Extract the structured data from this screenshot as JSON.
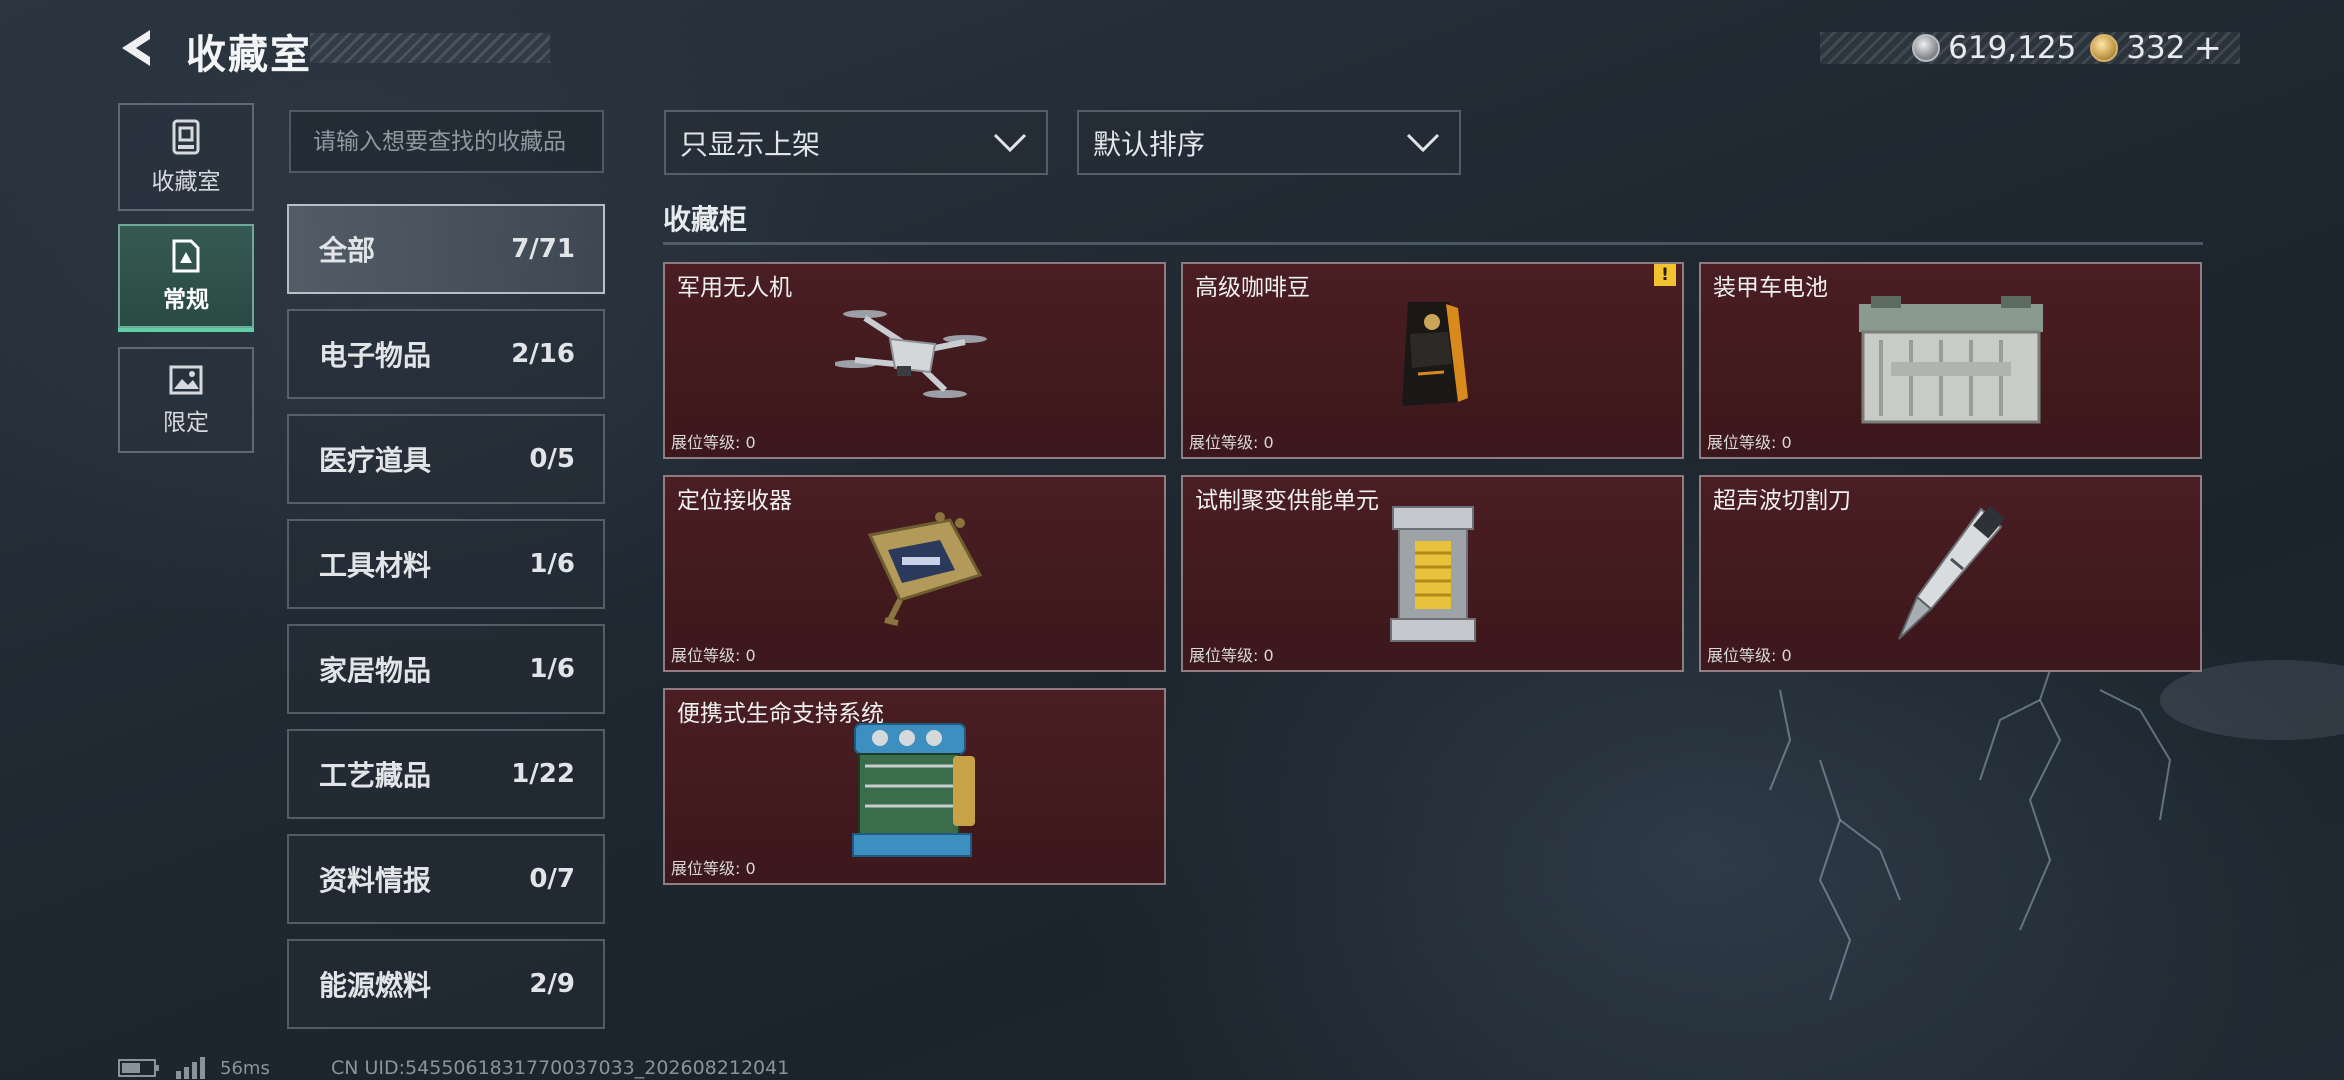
{
  "header": {
    "title": "收藏室",
    "currency_silver": "619,125",
    "currency_gold": "332",
    "plus_label": "+"
  },
  "side_tabs": [
    {
      "label": "收藏室",
      "icon": "vault-icon"
    },
    {
      "label": "常规",
      "icon": "document-icon"
    },
    {
      "label": "限定",
      "icon": "picture-icon"
    }
  ],
  "search": {
    "placeholder": "请输入想要查找的收藏品"
  },
  "categories": [
    {
      "name": "全部",
      "count": "7/71"
    },
    {
      "name": "电子物品",
      "count": "2/16"
    },
    {
      "name": "医疗道具",
      "count": "0/5"
    },
    {
      "name": "工具材料",
      "count": "1/6"
    },
    {
      "name": "家居物品",
      "count": "1/6"
    },
    {
      "name": "工艺藏品",
      "count": "1/22"
    },
    {
      "name": "资料情报",
      "count": "0/7"
    },
    {
      "name": "能源燃料",
      "count": "2/9"
    }
  ],
  "filters": {
    "filter_value": "只显示上架",
    "sort_value": "默认排序"
  },
  "section": {
    "title": "收藏柜"
  },
  "items": [
    {
      "name": "军用无人机",
      "level": "展位等级: 0",
      "icon": "drone-icon"
    },
    {
      "name": "高级咖啡豆",
      "level": "展位等级: 0",
      "icon": "coffee-bag-icon",
      "warning": "!"
    },
    {
      "name": "装甲车电池",
      "level": "展位等级: 0",
      "icon": "battery-icon"
    },
    {
      "name": "定位接收器",
      "level": "展位等级: 0",
      "icon": "gps-receiver-icon"
    },
    {
      "name": "试制聚变供能单元",
      "level": "展位等级: 0",
      "icon": "fusion-cell-icon"
    },
    {
      "name": "超声波切割刀",
      "level": "展位等级: 0",
      "icon": "ultrasonic-knife-icon"
    },
    {
      "name": "便携式生命支持系统",
      "level": "展位等级: 0",
      "icon": "life-support-icon"
    }
  ],
  "status": {
    "ping": "56ms",
    "uid": "CN UID:5455061831770037033_202608212041"
  }
}
